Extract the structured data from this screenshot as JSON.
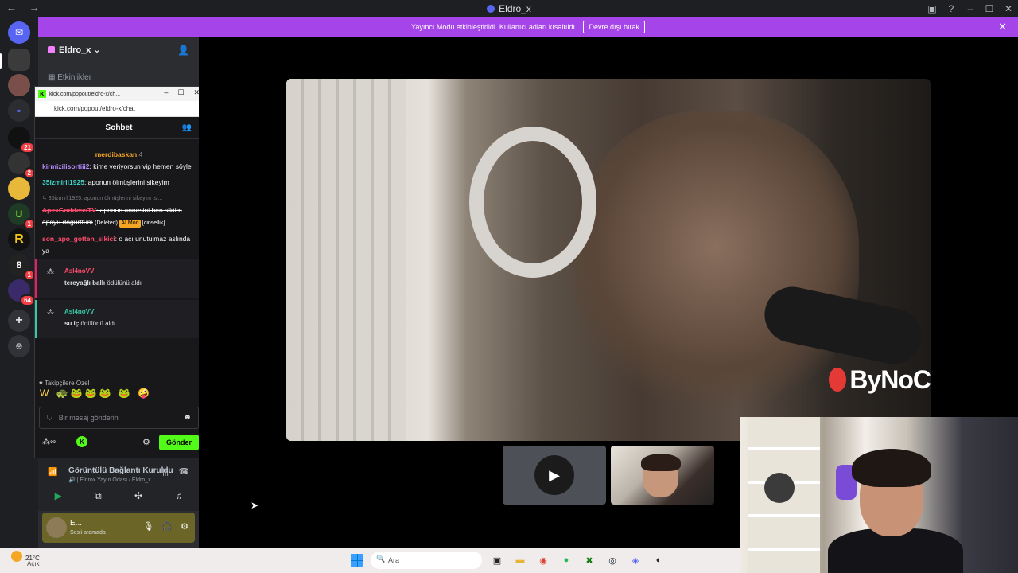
{
  "window": {
    "title": "Eldro_x",
    "nav": "← →",
    "controls": [
      "▣",
      "?",
      "–",
      "☐",
      "✕"
    ]
  },
  "banner": {
    "text": "Yayıncı Modu etkinleştirildi. Kullanıcı adları kısaltıldı.",
    "button": "Devre dışı bırak",
    "close": "✕"
  },
  "server": {
    "name": "Eldro_x",
    "caret": "⌄",
    "invite_icon": "add-user-icon",
    "events": "Etkinlikler"
  },
  "rail": {
    "badges": [
      "21",
      "2",
      "1",
      "1",
      "64"
    ],
    "letters": [
      "R"
    ]
  },
  "popout": {
    "window_title": "kick.com/popout/eldro-x/ch...",
    "url": "kick.com/popout/eldro-x/chat",
    "header": "Sohbet",
    "pinned_user": "merdibaskan",
    "pinned_count": "4",
    "messages": {
      "m1_user": "kirmizilisortiii2",
      "m1_text": ": kime veriyorsun vip hemen söyle",
      "m2_user": "35izmirli1925",
      "m2_text": ": aponun ölmüşlerini sikeyim",
      "m3_reply": "↳ 35izmirli1925: aponun ölmüşlerini sikeyim isi...",
      "m3_user": "ApexGoddessTV",
      "m3_text": ": aponun annesini ben siktim apoyu doğurttum",
      "m3_deleted": "(Deleted)",
      "m3_tag": "AI Mod",
      "m3_reason": "[cinsellik]",
      "m4_user": "son_apo_gotten_sikici",
      "m4_text": ": o acı unutulmaz aslında ya"
    },
    "events": [
      {
        "user": "Asl4noVV",
        "action": "tereyağlı ballı",
        "suffix": "ödülünü aldı"
      },
      {
        "user": "Asl4noVV",
        "action": "su iç",
        "suffix": "ödülünü aldı"
      }
    ],
    "follow_label": "♥ Takipçilere Özel",
    "emotes": "W 🐢🐸🐸🐸 🐸 🤪",
    "input_placeholder": "Bir mesaj gönderin",
    "send_label": "Gönder"
  },
  "voice": {
    "status": "Görüntülü Bağlantı Kuruldu",
    "channel": "🔊 | Eldrox Yayın Odası / Eldro_x"
  },
  "user": {
    "name": "E...",
    "status": "Sesli aramada"
  },
  "stage": {
    "watermark": "ByNoC"
  },
  "taskbar": {
    "temp": "21°C",
    "cond": "Açık",
    "search": "Ara"
  },
  "colors": {
    "banner": "#a544e8",
    "kick_green": "#53fc18",
    "discord_bg": "#2b2d31"
  }
}
